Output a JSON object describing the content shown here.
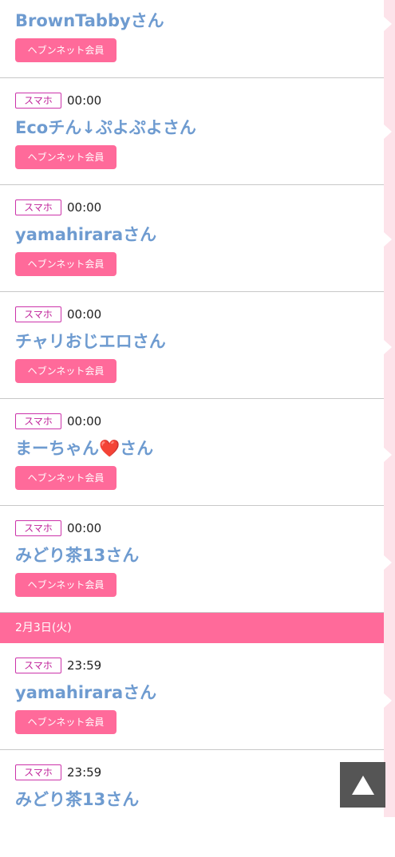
{
  "entries_before": [
    {
      "device": "",
      "time": "",
      "name": "BrownTabbyさん",
      "member": "ヘブンネット会員"
    },
    {
      "device": "スマホ",
      "time": "00:00",
      "name": "Ecoチん↓ぷよぷよさん",
      "member": "ヘブンネット会員"
    },
    {
      "device": "スマホ",
      "time": "00:00",
      "name": "yamahiraraさん",
      "member": "ヘブンネット会員"
    },
    {
      "device": "スマホ",
      "time": "00:00",
      "name": "チャリおじエロさん",
      "member": "ヘブンネット会員"
    },
    {
      "device": "スマホ",
      "time": "00:00",
      "name": "まーちゃん❤️さん",
      "member": "ヘブンネット会員"
    },
    {
      "device": "スマホ",
      "time": "00:00",
      "name": "みどり茶13さん",
      "member": "ヘブンネット会員"
    }
  ],
  "date_header": "2月3日(火)",
  "entries_after": [
    {
      "device": "スマホ",
      "time": "23:59",
      "name": "yamahiraraさん",
      "member": "ヘブンネット会員"
    },
    {
      "device": "スマホ",
      "time": "23:59",
      "name": "みどり茶13さん",
      "member": ""
    }
  ],
  "scroll_top": {
    "icon": "up-triangle-icon",
    "color": "#555555"
  },
  "colors": {
    "accent": "#ff6a9a",
    "name": "#6e9bd0",
    "device": "#c0249b",
    "strip": "#fde3ea"
  }
}
